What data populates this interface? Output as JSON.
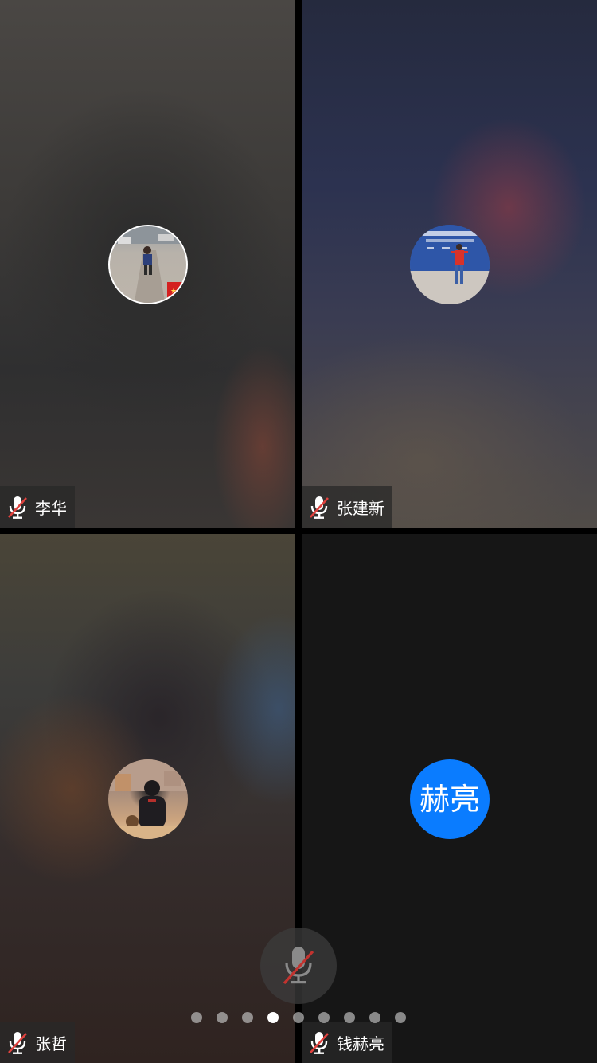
{
  "participants": [
    {
      "name": "李华",
      "muted": true,
      "avatar": "photo-child-on-street"
    },
    {
      "name": "张建新",
      "muted": true,
      "avatar": "photo-man-red-shirt-banner"
    },
    {
      "name": "张哲",
      "muted": true,
      "avatar": "photo-young-man-with-dog"
    },
    {
      "name": "钱赫亮",
      "muted": true,
      "avatar_initials": "赫亮",
      "avatar_color": "#0a7cff"
    }
  ],
  "controls": {
    "mic_state": "muted",
    "mic_icon": "mic-off-icon"
  },
  "pagination": {
    "total_pages": 9,
    "current_page": 4
  },
  "colors": {
    "mute_slash": "#e0423e",
    "avatar_blue": "#0a7cff"
  }
}
